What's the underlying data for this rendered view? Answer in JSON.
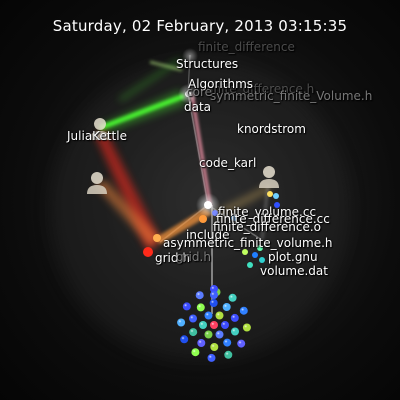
{
  "header": {
    "timestamp": "Saturday, 02 February, 2013 03:15:35"
  },
  "users": [
    {
      "name": "JuliaKettle"
    },
    {
      "name": "knordstrom"
    },
    {
      "name": "code_karl"
    }
  ],
  "directories": [
    {
      "name": "Structures"
    },
    {
      "name": "Algorithms"
    },
    {
      "name": "core"
    },
    {
      "name": "data"
    },
    {
      "name": "include"
    },
    {
      "name": "grid.h"
    }
  ],
  "files": [
    {
      "name": "finite_difference",
      "style": "ghost"
    },
    {
      "name": "finite_difference.h",
      "style": "ghost"
    },
    {
      "name": "symmetric_finite_Volume.h",
      "style": "faded"
    },
    {
      "name": "finite_difference.cc"
    },
    {
      "name": "finite_difference.o"
    },
    {
      "name": "asymmetric_finite_volume.h"
    },
    {
      "name": "plot.gnu"
    },
    {
      "name": "volume.dat"
    },
    {
      "name": "finite_volume.cc"
    },
    {
      "name": "grid.h"
    }
  ],
  "colors": {
    "background": "#0a0a0a",
    "edge": "#9a9a9a",
    "beam_green": "#4cff33",
    "beam_red": "#ff2a1a",
    "beam_orange": "#ff9a3c",
    "beam_pink": "#ff9ab0",
    "node_white": "#ffffff"
  }
}
